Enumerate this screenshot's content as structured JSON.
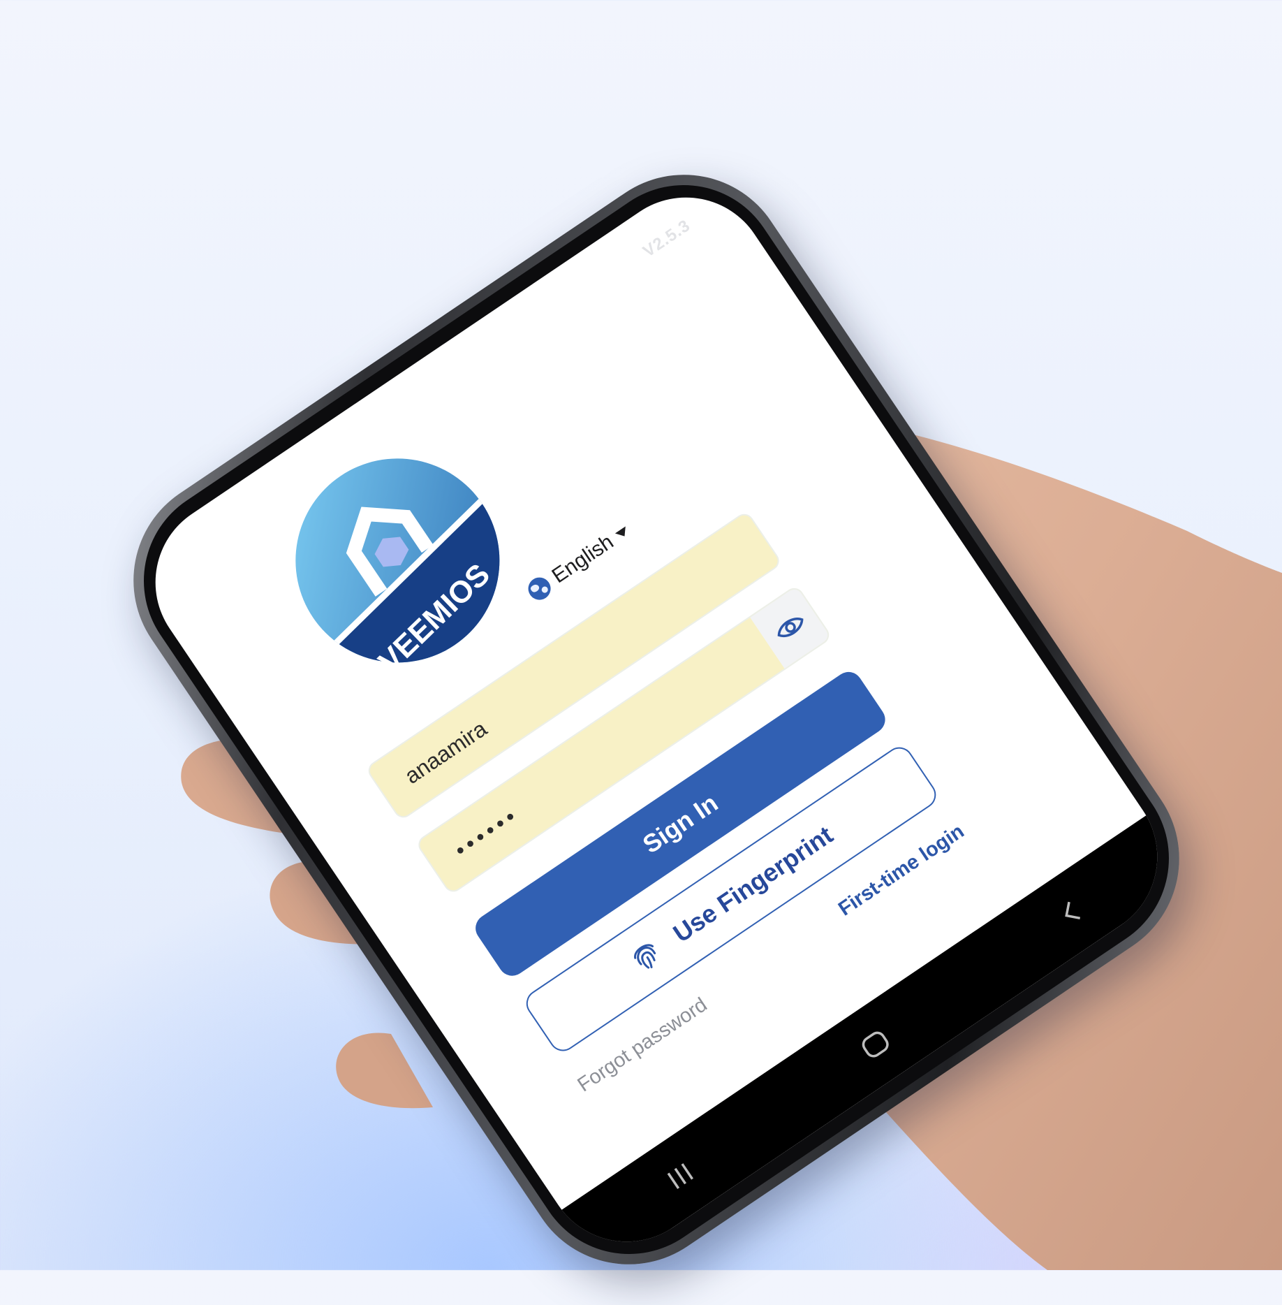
{
  "app": {
    "version": "V2.5.3",
    "logo_text": "VEEMIOS"
  },
  "language": {
    "selected": "English"
  },
  "login": {
    "username_value": "anaamira",
    "password_value": "••••••",
    "signin_label": "Sign In",
    "fingerprint_label": "Use Fingerprint",
    "forgot_label": "Forgot password",
    "first_time_label": "First-time login"
  },
  "colors": {
    "primary": "#3160b3",
    "autofill": "#f8f1c6",
    "link": "#2c56a8",
    "muted": "#8c8f96"
  }
}
